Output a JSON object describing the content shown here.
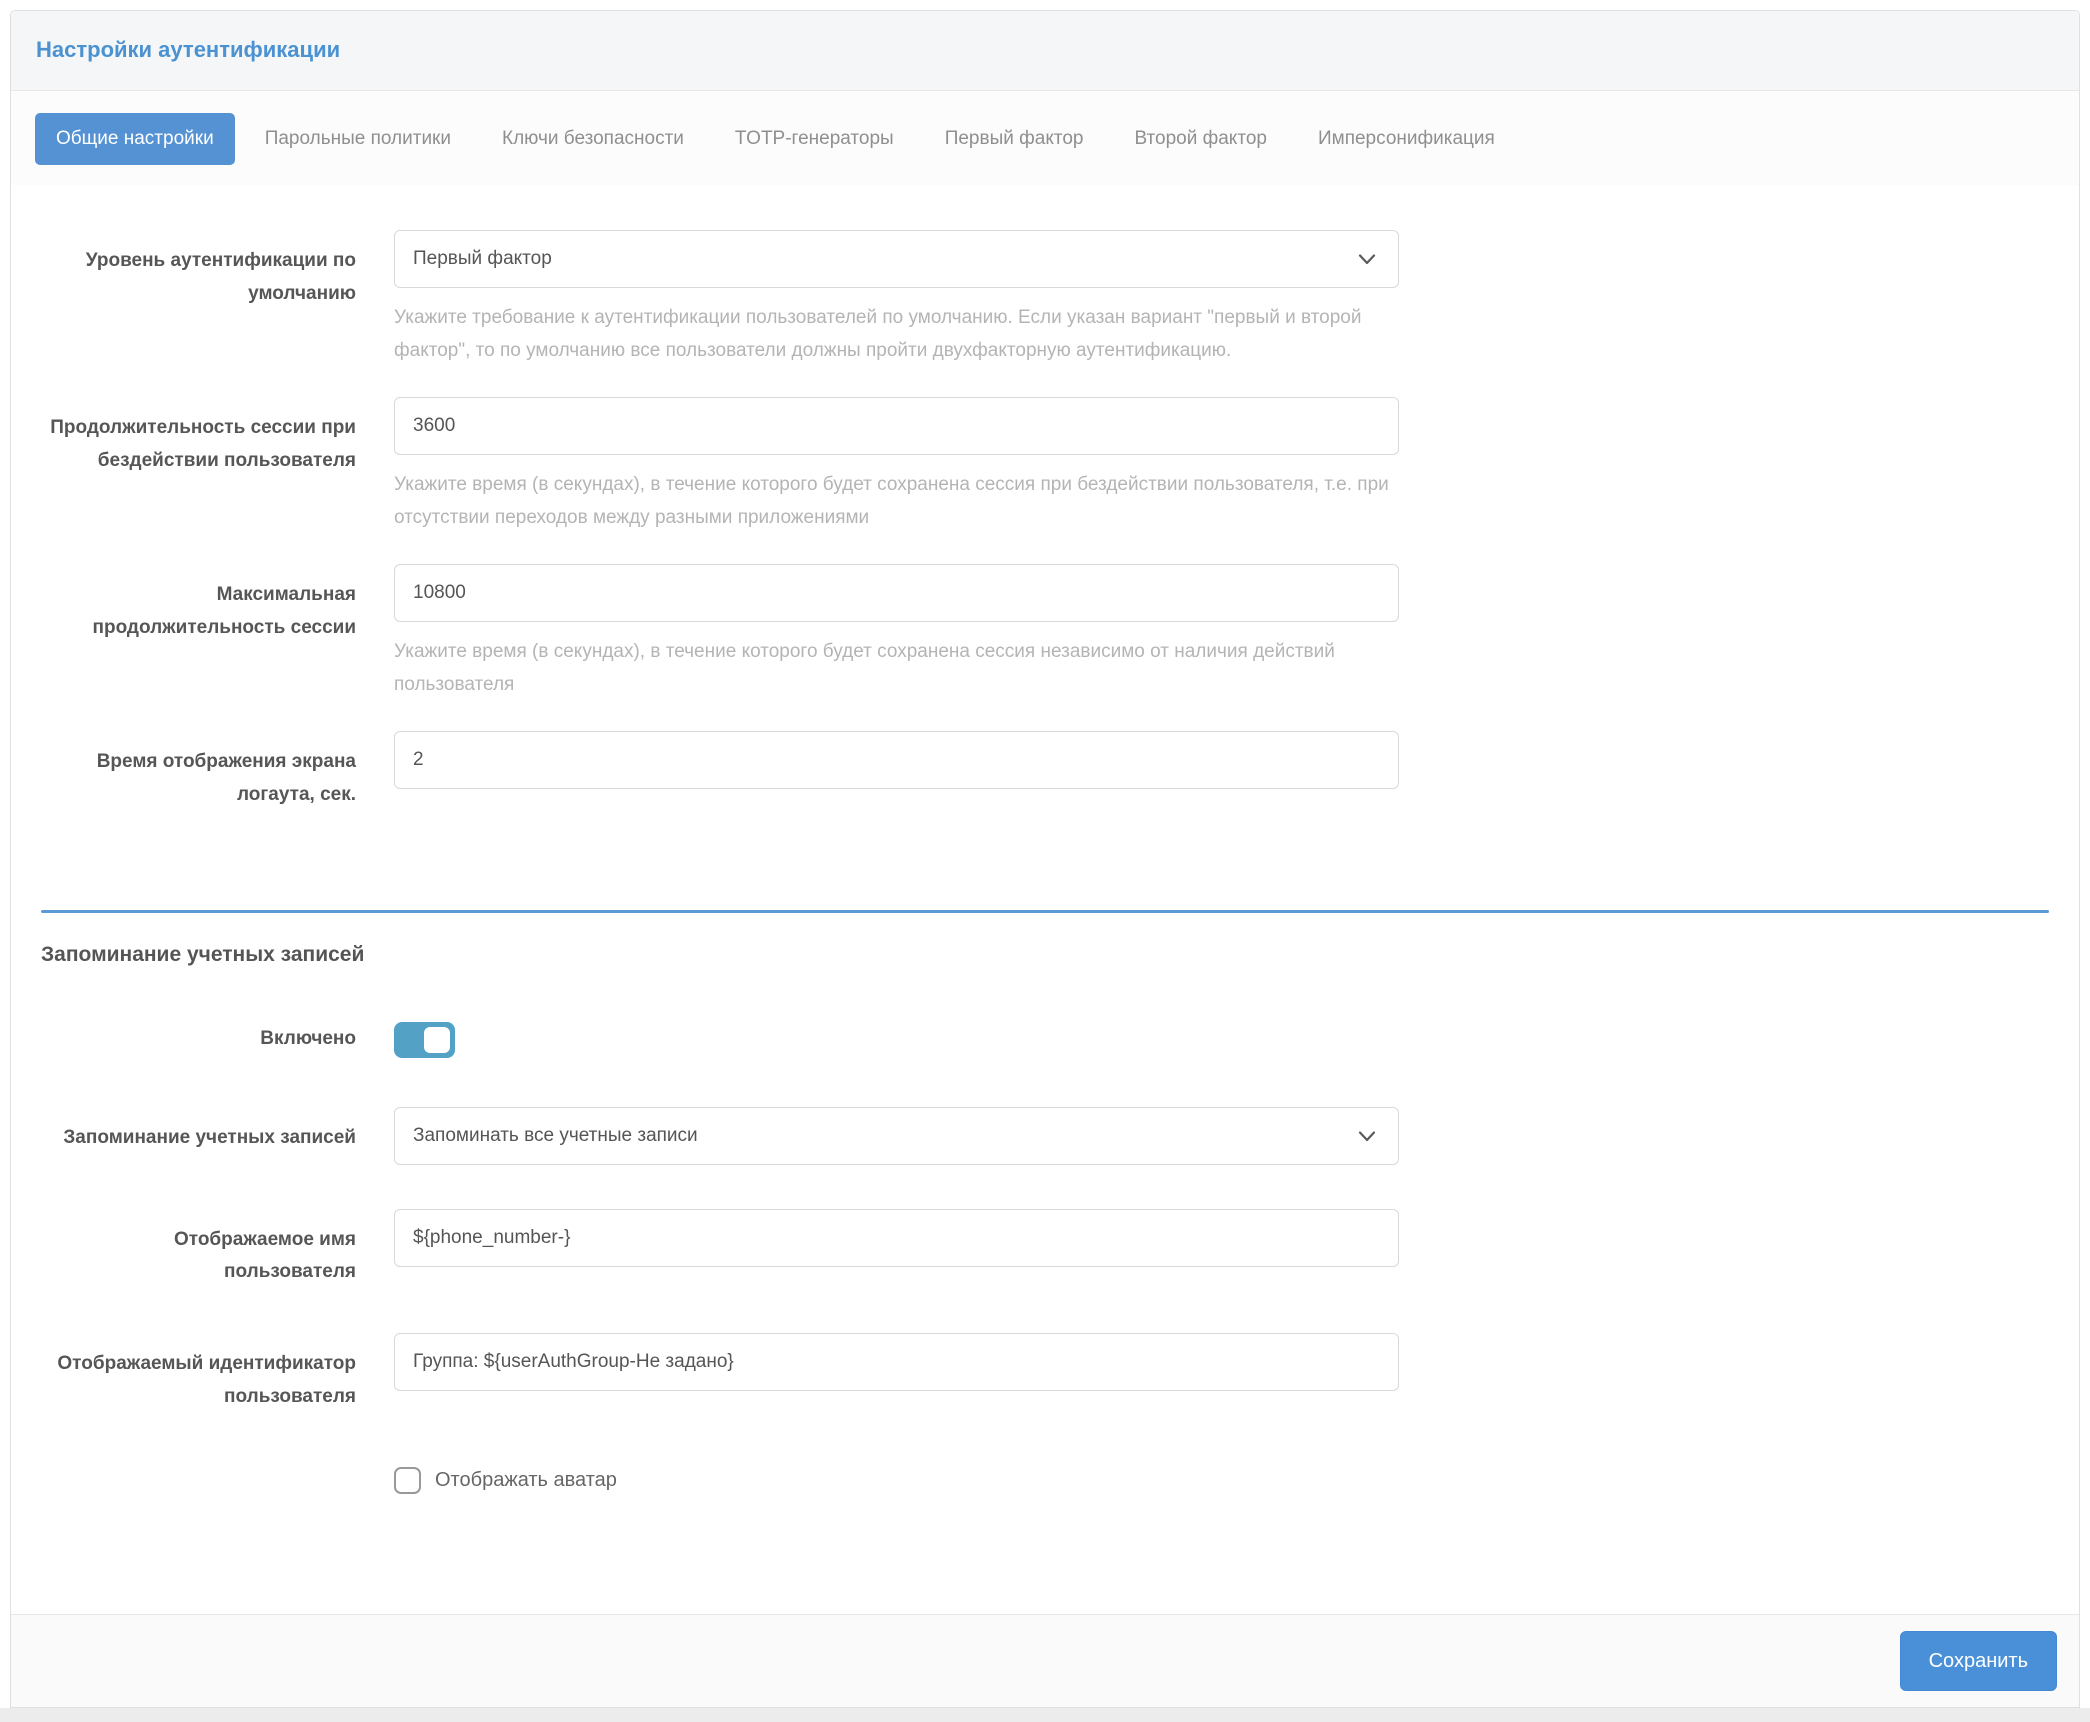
{
  "page": {
    "title": "Настройки аутентификации"
  },
  "tabs": [
    {
      "label": "Общие настройки",
      "active": true
    },
    {
      "label": "Парольные политики",
      "active": false
    },
    {
      "label": "Ключи безопасности",
      "active": false
    },
    {
      "label": "TOTP-генераторы",
      "active": false
    },
    {
      "label": "Первый фактор",
      "active": false
    },
    {
      "label": "Второй фактор",
      "active": false
    },
    {
      "label": "Имперсонификация",
      "active": false
    }
  ],
  "form": {
    "auth_level": {
      "label": "Уровень аутентификации по умолчанию",
      "value": "Первый фактор",
      "help": "Укажите требование к аутентификации пользователей по умолчанию. Если указан вариант \"первый и второй фактор\", то по умолчанию все пользователи должны пройти двухфакторную аутентификацию."
    },
    "idle_session_duration": {
      "label": "Продолжительность сессии при бездействии пользователя",
      "value": "3600",
      "help": "Укажите время (в секундах), в течение которого будет сохранена сессия при бездействии пользователя, т.е. при отсутствии переходов между разными приложениями"
    },
    "max_session_duration": {
      "label": "Максимальная продолжительность сессии",
      "value": "10800",
      "help": "Укажите время (в секундах), в течение которого будет сохранена сессия независимо от наличия действий пользователя"
    },
    "logout_screen_time": {
      "label": "Время отображения экрана логаута, сек.",
      "value": "2"
    }
  },
  "remember_section": {
    "title": "Запоминание учетных записей",
    "enabled": {
      "label": "Включено",
      "value": true
    },
    "mode": {
      "label": "Запоминание учетных записей",
      "value": "Запоминать все учетные записи"
    },
    "display_name": {
      "label": "Отображаемое имя пользователя",
      "value": "${phone_number-}"
    },
    "display_id": {
      "label": "Отображаемый идентификатор пользователя",
      "value": "Группа: ${userAuthGroup-Не задано}"
    },
    "show_avatar": {
      "label": "Отображать аватар",
      "checked": false
    }
  },
  "footer": {
    "save_label": "Сохранить"
  },
  "colors": {
    "title_blue": "#4b92d2",
    "active_tab_blue": "#5592d4",
    "divider_blue": "#5b9bd5",
    "toggle_blue": "#54a1c6",
    "save_button_blue": "#4a90d9",
    "help_gray": "#b4b4b4",
    "header_bg": "#f5f6f7",
    "footer_bg": "#fafafa"
  }
}
